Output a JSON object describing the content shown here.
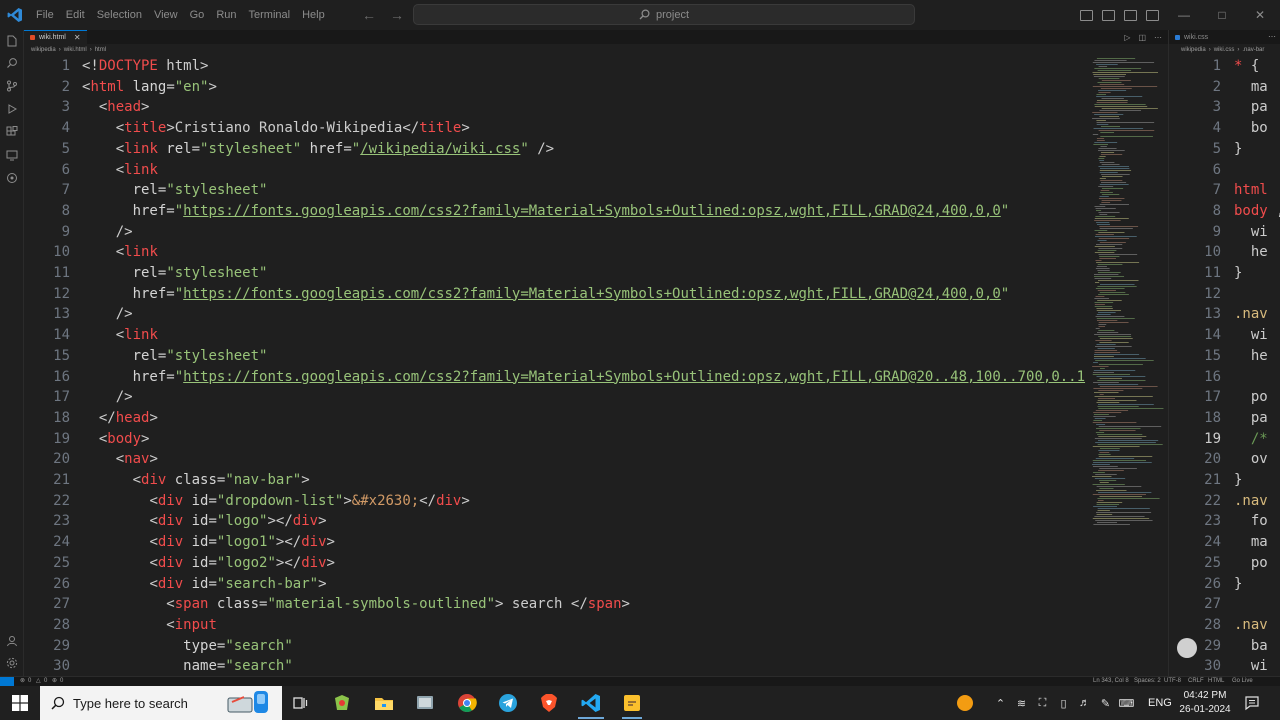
{
  "menu": [
    "File",
    "Edit",
    "Selection",
    "View",
    "Go",
    "Run",
    "Terminal",
    "Help"
  ],
  "search": {
    "label": "project"
  },
  "editor1": {
    "tab": {
      "label": "wiki.html"
    },
    "breadcrumb": [
      "wikipedia",
      "wiki.html",
      "html"
    ],
    "lines": [
      {
        "n": "1",
        "t": [
          [
            "pn",
            "<!"
          ],
          [
            "tg",
            "DOCTYPE"
          ],
          [
            "tx",
            " html"
          ],
          [
            "pn",
            ">"
          ]
        ]
      },
      {
        "n": "2",
        "t": [
          [
            "pn",
            "<"
          ],
          [
            "tg",
            "html"
          ],
          [
            "at",
            " lang"
          ],
          [
            "pn",
            "="
          ],
          [
            "sg",
            "\"en\""
          ],
          [
            "pn",
            ">"
          ]
        ]
      },
      {
        "n": "3",
        "t": [
          [
            "tx",
            "  "
          ],
          [
            "pn",
            "<"
          ],
          [
            "tg",
            "head"
          ],
          [
            "pn",
            ">"
          ]
        ]
      },
      {
        "n": "4",
        "t": [
          [
            "tx",
            "    "
          ],
          [
            "pn",
            "<"
          ],
          [
            "tg",
            "title"
          ],
          [
            "pn",
            ">"
          ],
          [
            "tx",
            "Cristiano Ronaldo-Wikipedia"
          ],
          [
            "pn",
            "</"
          ],
          [
            "tg",
            "title"
          ],
          [
            "pn",
            ">"
          ]
        ]
      },
      {
        "n": "5",
        "t": [
          [
            "tx",
            "    "
          ],
          [
            "pn",
            "<"
          ],
          [
            "tg",
            "link"
          ],
          [
            "at",
            " rel"
          ],
          [
            "pn",
            "="
          ],
          [
            "sg",
            "\"stylesheet\""
          ],
          [
            "at",
            " href"
          ],
          [
            "pn",
            "="
          ],
          [
            "sg",
            "\""
          ],
          [
            "ul",
            "/wikipedia/wiki.css"
          ],
          [
            "sg",
            "\""
          ],
          [
            "pn",
            " />"
          ]
        ]
      },
      {
        "n": "6",
        "t": [
          [
            "tx",
            "    "
          ],
          [
            "pn",
            "<"
          ],
          [
            "tg",
            "link"
          ]
        ]
      },
      {
        "n": "7",
        "t": [
          [
            "tx",
            "      "
          ],
          [
            "at",
            "rel"
          ],
          [
            "pn",
            "="
          ],
          [
            "sg",
            "\"stylesheet\""
          ]
        ]
      },
      {
        "n": "8",
        "t": [
          [
            "tx",
            "      "
          ],
          [
            "at",
            "href"
          ],
          [
            "pn",
            "="
          ],
          [
            "sg",
            "\""
          ],
          [
            "ul",
            "https://fonts.googleapis.com/css2?family=Material+Symbols+Outlined:opsz,wght,FILL,GRAD@24,400,0,0"
          ],
          [
            "sg",
            "\""
          ]
        ]
      },
      {
        "n": "9",
        "t": [
          [
            "tx",
            "    "
          ],
          [
            "pn",
            "/>"
          ]
        ]
      },
      {
        "n": "10",
        "t": [
          [
            "tx",
            "    "
          ],
          [
            "pn",
            "<"
          ],
          [
            "tg",
            "link"
          ]
        ]
      },
      {
        "n": "11",
        "t": [
          [
            "tx",
            "      "
          ],
          [
            "at",
            "rel"
          ],
          [
            "pn",
            "="
          ],
          [
            "sg",
            "\"stylesheet\""
          ]
        ]
      },
      {
        "n": "12",
        "t": [
          [
            "tx",
            "      "
          ],
          [
            "at",
            "href"
          ],
          [
            "pn",
            "="
          ],
          [
            "sg",
            "\""
          ],
          [
            "ul",
            "https://fonts.googleapis.com/css2?family=Material+Symbols+Outlined:opsz,wght,FILL,GRAD@24,400,0,0"
          ],
          [
            "sg",
            "\""
          ]
        ]
      },
      {
        "n": "13",
        "t": [
          [
            "tx",
            "    "
          ],
          [
            "pn",
            "/>"
          ]
        ]
      },
      {
        "n": "14",
        "t": [
          [
            "tx",
            "    "
          ],
          [
            "pn",
            "<"
          ],
          [
            "tg",
            "link"
          ]
        ]
      },
      {
        "n": "15",
        "t": [
          [
            "tx",
            "      "
          ],
          [
            "at",
            "rel"
          ],
          [
            "pn",
            "="
          ],
          [
            "sg",
            "\"stylesheet\""
          ]
        ]
      },
      {
        "n": "16",
        "t": [
          [
            "tx",
            "      "
          ],
          [
            "at",
            "href"
          ],
          [
            "pn",
            "="
          ],
          [
            "sg",
            "\""
          ],
          [
            "ul",
            "https://fonts.googleapis.com/css2?family=Material+Symbols+Outlined:opsz,wght,FILL,GRAD@20..48,100..700,0..1"
          ]
        ]
      },
      {
        "n": "17",
        "t": [
          [
            "tx",
            "    "
          ],
          [
            "pn",
            "/>"
          ]
        ]
      },
      {
        "n": "18",
        "t": [
          [
            "tx",
            "  "
          ],
          [
            "pn",
            "</"
          ],
          [
            "tg",
            "head"
          ],
          [
            "pn",
            ">"
          ]
        ]
      },
      {
        "n": "19",
        "t": [
          [
            "tx",
            "  "
          ],
          [
            "pn",
            "<"
          ],
          [
            "tg",
            "body"
          ],
          [
            "pn",
            ">"
          ]
        ]
      },
      {
        "n": "20",
        "t": [
          [
            "tx",
            "    "
          ],
          [
            "pn",
            "<"
          ],
          [
            "tg",
            "nav"
          ],
          [
            "pn",
            ">"
          ]
        ]
      },
      {
        "n": "21",
        "t": [
          [
            "tx",
            "      "
          ],
          [
            "pn",
            "<"
          ],
          [
            "tg",
            "div"
          ],
          [
            "at",
            " class"
          ],
          [
            "pn",
            "="
          ],
          [
            "sg",
            "\"nav-bar\""
          ],
          [
            "pn",
            ">"
          ]
        ]
      },
      {
        "n": "22",
        "t": [
          [
            "tx",
            "        "
          ],
          [
            "pn",
            "<"
          ],
          [
            "tg",
            "div"
          ],
          [
            "at",
            " id"
          ],
          [
            "pn",
            "="
          ],
          [
            "sg",
            "\"dropdown-list\""
          ],
          [
            "pn",
            ">"
          ],
          [
            "ent",
            "&#x2630;"
          ],
          [
            "pn",
            "</"
          ],
          [
            "tg",
            "div"
          ],
          [
            "pn",
            ">"
          ]
        ]
      },
      {
        "n": "23",
        "t": [
          [
            "tx",
            "        "
          ],
          [
            "pn",
            "<"
          ],
          [
            "tg",
            "div"
          ],
          [
            "at",
            " id"
          ],
          [
            "pn",
            "="
          ],
          [
            "sg",
            "\"logo\""
          ],
          [
            "pn",
            "></"
          ],
          [
            "tg",
            "div"
          ],
          [
            "pn",
            ">"
          ]
        ]
      },
      {
        "n": "24",
        "t": [
          [
            "tx",
            "        "
          ],
          [
            "pn",
            "<"
          ],
          [
            "tg",
            "div"
          ],
          [
            "at",
            " id"
          ],
          [
            "pn",
            "="
          ],
          [
            "sg",
            "\"logo1\""
          ],
          [
            "pn",
            "></"
          ],
          [
            "tg",
            "div"
          ],
          [
            "pn",
            ">"
          ]
        ]
      },
      {
        "n": "25",
        "t": [
          [
            "tx",
            "        "
          ],
          [
            "pn",
            "<"
          ],
          [
            "tg",
            "div"
          ],
          [
            "at",
            " id"
          ],
          [
            "pn",
            "="
          ],
          [
            "sg",
            "\"logo2\""
          ],
          [
            "pn",
            "></"
          ],
          [
            "tg",
            "div"
          ],
          [
            "pn",
            ">"
          ]
        ]
      },
      {
        "n": "26",
        "t": [
          [
            "tx",
            "        "
          ],
          [
            "pn",
            "<"
          ],
          [
            "tg",
            "div"
          ],
          [
            "at",
            " id"
          ],
          [
            "pn",
            "="
          ],
          [
            "sg",
            "\"search-bar\""
          ],
          [
            "pn",
            ">"
          ]
        ]
      },
      {
        "n": "27",
        "t": [
          [
            "tx",
            "          "
          ],
          [
            "pn",
            "<"
          ],
          [
            "tg",
            "span"
          ],
          [
            "at",
            " class"
          ],
          [
            "pn",
            "="
          ],
          [
            "sg",
            "\"material-symbols-outlined\""
          ],
          [
            "pn",
            ">"
          ],
          [
            "tx",
            " search "
          ],
          [
            "pn",
            "</"
          ],
          [
            "tg",
            "span"
          ],
          [
            "pn",
            ">"
          ]
        ]
      },
      {
        "n": "28",
        "t": [
          [
            "tx",
            "          "
          ],
          [
            "pn",
            "<"
          ],
          [
            "tg",
            "input"
          ]
        ]
      },
      {
        "n": "29",
        "t": [
          [
            "tx",
            "            "
          ],
          [
            "at",
            "type"
          ],
          [
            "pn",
            "="
          ],
          [
            "sg",
            "\"search\""
          ]
        ]
      },
      {
        "n": "30",
        "t": [
          [
            "tx",
            "            "
          ],
          [
            "at",
            "name"
          ],
          [
            "pn",
            "="
          ],
          [
            "sg",
            "\"search\""
          ]
        ]
      }
    ]
  },
  "editor2": {
    "tab": {
      "label": "wiki.css"
    },
    "breadcrumb": [
      "wikipedia",
      "wiki.css",
      ".nav-bar"
    ],
    "active_line": "19",
    "lines": [
      {
        "n": "1",
        "t": [
          [
            "tg",
            "*"
          ],
          [
            "pn",
            " {"
          ]
        ]
      },
      {
        "n": "2",
        "t": [
          [
            "tx",
            "  ma"
          ]
        ]
      },
      {
        "n": "3",
        "t": [
          [
            "tx",
            "  pa"
          ]
        ]
      },
      {
        "n": "4",
        "t": [
          [
            "tx",
            "  bo"
          ]
        ]
      },
      {
        "n": "5",
        "t": [
          [
            "pn",
            "}"
          ]
        ]
      },
      {
        "n": "6",
        "t": []
      },
      {
        "n": "7",
        "t": [
          [
            "tg",
            "html"
          ]
        ]
      },
      {
        "n": "8",
        "t": [
          [
            "tg",
            "body"
          ],
          [
            "pn",
            " ,"
          ]
        ]
      },
      {
        "n": "9",
        "t": [
          [
            "tx",
            "  wi"
          ]
        ]
      },
      {
        "n": "10",
        "t": [
          [
            "tx",
            "  he"
          ]
        ]
      },
      {
        "n": "11",
        "t": [
          [
            "pn",
            "}"
          ]
        ]
      },
      {
        "n": "12",
        "t": []
      },
      {
        "n": "13",
        "t": [
          [
            "cls",
            ".nav"
          ]
        ]
      },
      {
        "n": "14",
        "t": [
          [
            "tx",
            "  wi"
          ]
        ]
      },
      {
        "n": "15",
        "t": [
          [
            "tx",
            "  he"
          ]
        ]
      },
      {
        "n": "16",
        "t": []
      },
      {
        "n": "17",
        "t": [
          [
            "tx",
            "  po"
          ]
        ]
      },
      {
        "n": "18",
        "t": [
          [
            "tx",
            "  pa"
          ]
        ]
      },
      {
        "n": "19",
        "t": [
          [
            "cmt",
            "  /*"
          ]
        ]
      },
      {
        "n": "20",
        "t": [
          [
            "tx",
            "  ov"
          ]
        ]
      },
      {
        "n": "21",
        "t": [
          [
            "pn",
            "}"
          ]
        ]
      },
      {
        "n": "22",
        "t": [
          [
            "cls",
            ".nav"
          ]
        ]
      },
      {
        "n": "23",
        "t": [
          [
            "tx",
            "  fo"
          ]
        ]
      },
      {
        "n": "24",
        "t": [
          [
            "tx",
            "  ma"
          ]
        ]
      },
      {
        "n": "25",
        "t": [
          [
            "tx",
            "  po"
          ]
        ]
      },
      {
        "n": "26",
        "t": [
          [
            "pn",
            "}"
          ]
        ]
      },
      {
        "n": "27",
        "t": []
      },
      {
        "n": "28",
        "t": [
          [
            "cls",
            ".nav"
          ]
        ]
      },
      {
        "n": "29",
        "t": [
          [
            "tx",
            "  ba"
          ]
        ]
      },
      {
        "n": "30",
        "t": [
          [
            "tx",
            "  wi"
          ]
        ]
      }
    ]
  },
  "status": {
    "errors": "0",
    "warnings": "0",
    "position": "Ln 343, Col 8",
    "spaces": "Spaces: 2",
    "encoding": "UTF-8",
    "eol": "CRLF",
    "language": "HTML",
    "golive": "Go Live"
  },
  "taskbar": {
    "search_placeholder": "Type here to search",
    "language": "ENG",
    "time": "04:42 PM",
    "date": "26-01-2024"
  },
  "colors": {
    "accent": "#0078d4",
    "tag": "#f14c4c",
    "string": "#98c379"
  }
}
